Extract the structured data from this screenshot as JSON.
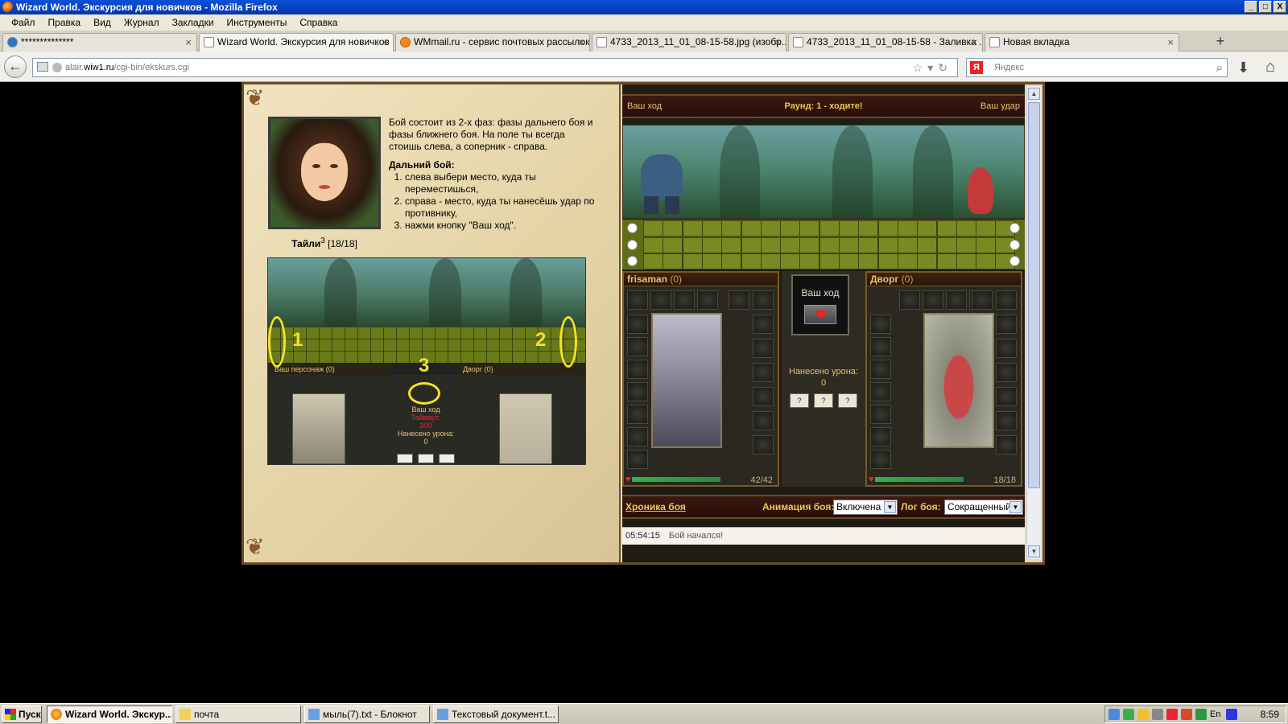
{
  "window": {
    "title": "Wizard World. Экскурсия для новичков - Mozilla Firefox",
    "buttons": [
      "_",
      "□",
      "X"
    ]
  },
  "menu": [
    "Файл",
    "Правка",
    "Вид",
    "Журнал",
    "Закладки",
    "Инструменты",
    "Справка"
  ],
  "tabs": [
    {
      "label": "**************",
      "active": false
    },
    {
      "label": "Wizard World. Экскурсия для новичков",
      "active": true
    },
    {
      "label": "WMmail.ru - сервис почтовых рассылок...",
      "active": false
    },
    {
      "label": "4733_2013_11_01_08-15-58.jpg (изобр...",
      "active": false
    },
    {
      "label": "4733_2013_11_01_08-15-58 - Заливка ...",
      "active": false
    },
    {
      "label": "Новая вкладка",
      "active": false
    }
  ],
  "new_tab_label": "+",
  "url": {
    "prefix": "alair.",
    "domain": "wiw1.ru",
    "path": "/cgi-bin/ekskurs.cgi"
  },
  "search": {
    "placeholder": "Яндекс",
    "engine_letter": "Я"
  },
  "tutorial": {
    "character_name": "Тайли",
    "character_level": "3",
    "character_hp": "[18/18]",
    "intro": "Бой состоит из 2-х фаз: фазы дальнего боя и фазы ближнего боя. На поле ты всегда стоишь слева, а соперник - справа.",
    "ranged_heading": "Дальний бой:",
    "steps": [
      "слева выбери место, куда ты переместишься,",
      "справа - место, куда ты нанесёшь удар по противнику,",
      "нажми кнопку \"Ваш ход\"."
    ],
    "image": {
      "left_label": "Ваш персонаж",
      "left_count": "(0)",
      "right_label": "Дворг",
      "right_count": "(0)",
      "num1": "1",
      "num2": "2",
      "num3": "3",
      "mid_move": "Ваш ход",
      "mid_timeout": "Таймаут:",
      "mid_timeout_value": "300",
      "mid_dmg": "Нанесено урона:",
      "mid_dmg_value": "0"
    }
  },
  "battle": {
    "your_move": "Ваш ход",
    "round": "Раунд: 1 - ходите!",
    "your_strike": "Ваш удар",
    "player": {
      "name": "frisaman",
      "count": "(0)",
      "hp": "42/42",
      "hp_fraction": 1.0
    },
    "enemy": {
      "name": "Дворг",
      "count": "(0)",
      "hp": "18/18",
      "hp_fraction": 1.0
    },
    "move_button": "Ваш ход",
    "damage_label": "Нанесено урона:",
    "damage_value": "0",
    "slot_labels": [
      "?",
      "?",
      "?"
    ],
    "help_label": "?"
  },
  "chronicle": {
    "link": "Хроника боя",
    "anim_label": "Анимация боя:",
    "anim_value": "Включена",
    "log_label": "Лог боя:",
    "log_value": "Сокращенный",
    "entries": [
      {
        "time": "05:54:15",
        "text": "Бой начался!"
      }
    ]
  },
  "taskbar": {
    "start": "Пуск",
    "tasks": [
      {
        "label": "Wizard World. Экскур...",
        "active": true
      },
      {
        "label": "почта",
        "active": false
      },
      {
        "label": "мыль(7).txt - Блокнот",
        "active": false
      },
      {
        "label": "Текстовый документ.t...",
        "active": false
      }
    ],
    "lang": "En",
    "clock": "8:59"
  },
  "colors": {
    "titlebar": "#0a50d8",
    "panel_gold": "#e8c070",
    "highlight": "#f4e12a",
    "hp_green": "#2bb54a"
  }
}
